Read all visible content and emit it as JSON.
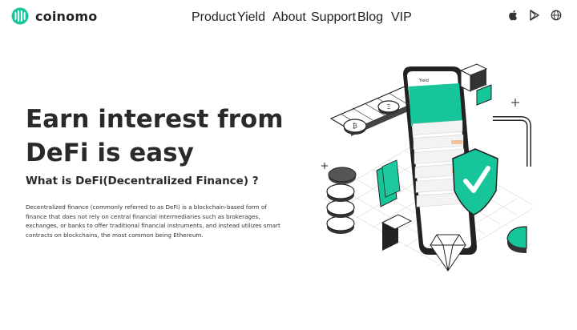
{
  "brand": {
    "name": "coinomo",
    "accent": "#16c59a"
  },
  "nav": {
    "items": [
      {
        "label": "Product",
        "active": false
      },
      {
        "label": "Yield",
        "active": true
      },
      {
        "label": "About",
        "active": false
      },
      {
        "label": "Support",
        "active": false
      },
      {
        "label": "Blog",
        "active": false
      },
      {
        "label": "VIP",
        "active": false
      }
    ]
  },
  "header_icons": [
    "apple-icon",
    "play-store-icon",
    "globe-icon"
  ],
  "hero": {
    "title_line1": "Earn interest from",
    "title_line2": "DeFi is easy",
    "subtitle": "What is DeFi(Decentralized Finance) ?",
    "description": "Decentralized finance (commonly referred to as DeFi) is a blockchain-based form of finance that does not rely on central financial intermediaries such as brokerages, exchanges, or banks to offer traditional financial instruments, and instead utilizes smart contracts on blockchains, the most common being Ethereum."
  },
  "phone": {
    "screen_title": "Yield"
  }
}
